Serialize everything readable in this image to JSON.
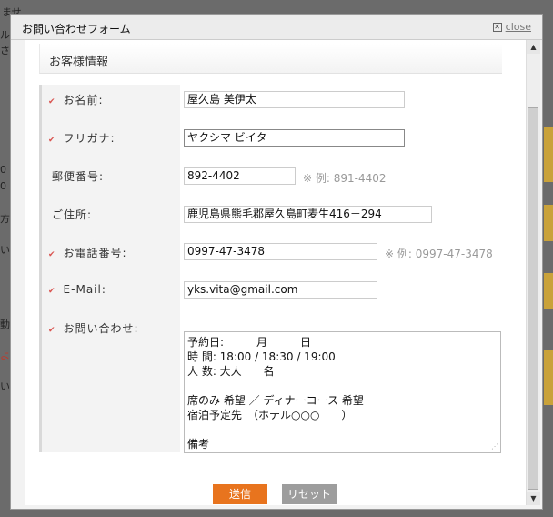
{
  "modal": {
    "title": "お問い合わせフォーム",
    "close_label": "close"
  },
  "section": {
    "title": "お客様情報"
  },
  "fields": {
    "name": {
      "label": "お名前:",
      "value": "屋久島 美伊太",
      "required": true
    },
    "furigana": {
      "label": "フリガナ:",
      "value": "ヤクシマ ビイタ",
      "required": true
    },
    "postal": {
      "label": "郵便番号:",
      "value": "892-4402",
      "hint": "※ 例: 891-4402",
      "required": false
    },
    "address": {
      "label": "ご住所:",
      "value": "鹿児島県熊毛郡屋久島町麦生416－294",
      "required": false
    },
    "phone": {
      "label": "お電話番号:",
      "value": "0997-47-3478",
      "hint": "※ 例: 0997-47-3478",
      "required": true
    },
    "email": {
      "label": "E-Mail:",
      "value": "yks.vita@gmail.com",
      "required": true
    },
    "inquiry": {
      "label": "お問い合わせ:",
      "value": "予約日:　　　月　　　日\n時 間: 18:00 / 18:30 / 19:00\n人 数: 大人　　名\n\n席のみ 希望 ／ ディナーコース 希望\n宿泊予定先　（ホテル○○○　　）\n\n備考",
      "required": true
    }
  },
  "buttons": {
    "submit": "送信",
    "reset": "リセット"
  },
  "background": {
    "fragments": [
      "ませ",
      "ル",
      "さ",
      "0",
      "0",
      "方",
      "い",
      "動",
      "よ",
      "い"
    ]
  },
  "colors": {
    "accent": "#e8741e",
    "required_mark": "#d9534f",
    "reset_button": "#9d9d9d"
  }
}
